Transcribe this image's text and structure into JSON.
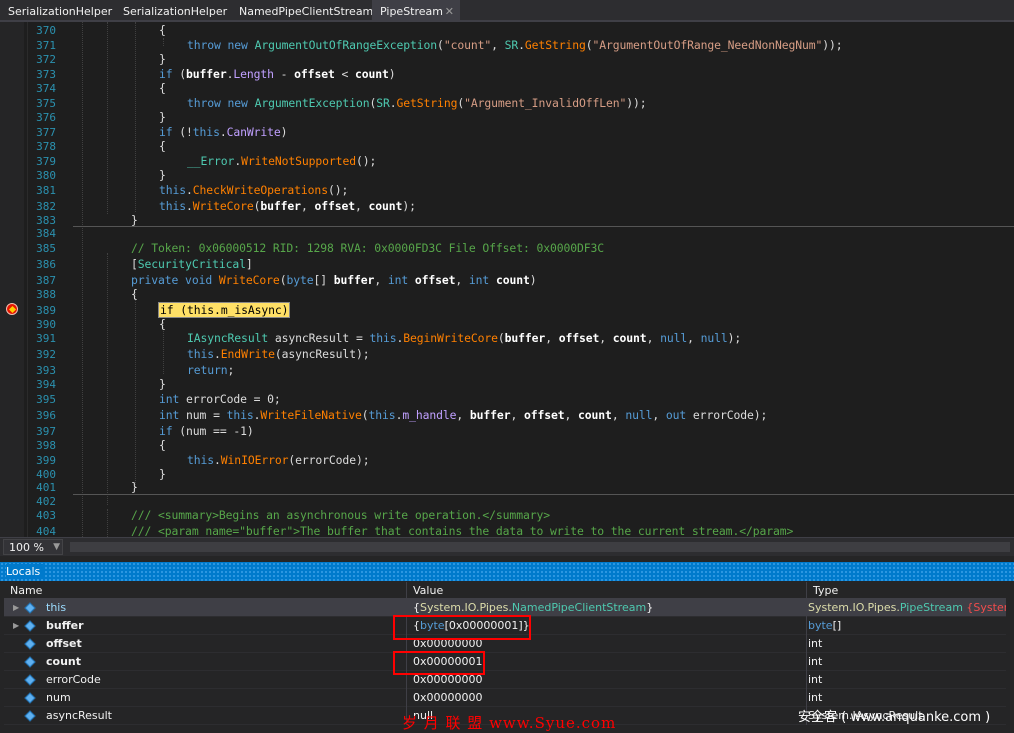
{
  "tabs": [
    {
      "label": "SerializationHelper"
    },
    {
      "label": "SerializationHelper"
    },
    {
      "label": "NamedPipeClientStream"
    },
    {
      "label": "PipeStream",
      "active": true
    }
  ],
  "tab_close_glyph": "✕",
  "editor": {
    "breakpoint_line": "389",
    "breakpoint_color": "#e51400",
    "highlight_color": "#ffe066",
    "lines": [
      {
        "n": "370"
      },
      {
        "n": "371"
      },
      {
        "n": "372"
      },
      {
        "n": "373"
      },
      {
        "n": "374"
      },
      {
        "n": "375"
      },
      {
        "n": "376"
      },
      {
        "n": "377"
      },
      {
        "n": "378"
      },
      {
        "n": "379"
      },
      {
        "n": "380"
      },
      {
        "n": "381"
      },
      {
        "n": "382"
      },
      {
        "n": "383"
      },
      {
        "n": "384"
      },
      {
        "n": "385"
      },
      {
        "n": "386"
      },
      {
        "n": "387"
      },
      {
        "n": "388"
      },
      {
        "n": "389"
      },
      {
        "n": "390"
      },
      {
        "n": "391"
      },
      {
        "n": "392"
      },
      {
        "n": "393"
      },
      {
        "n": "394"
      },
      {
        "n": "395"
      },
      {
        "n": "396"
      },
      {
        "n": "397"
      },
      {
        "n": "398"
      },
      {
        "n": "399"
      },
      {
        "n": "400"
      },
      {
        "n": "401"
      },
      {
        "n": "402"
      },
      {
        "n": "403"
      },
      {
        "n": "404"
      }
    ],
    "code": {
      "l370": "{",
      "l371": "throw new ArgumentOutOfRangeException(\"count\", SR.GetString(\"ArgumentOutOfRange_NeedNonNegNum\"));",
      "l372": "}",
      "l373": "if (buffer.Length - offset < count)",
      "l374": "{",
      "l375": "throw new ArgumentException(SR.GetString(\"Argument_InvalidOffLen\"));",
      "l376": "}",
      "l377": "if (!this.CanWrite)",
      "l378": "{",
      "l379": "__Error.WriteNotSupported();",
      "l380": "}",
      "l381": "this.CheckWriteOperations();",
      "l382": "this.WriteCore(buffer, offset, count);",
      "l383": "}",
      "l385": "// Token: 0x06000512 RID: 1298 RVA: 0x0000FD3C File Offset: 0x0000DF3C",
      "l386": "[SecurityCritical]",
      "l387": "private void WriteCore(byte[] buffer, int offset, int count)",
      "l388": "{",
      "l389": "if (this.m_isAsync)",
      "l390": "{",
      "l391": "IAsyncResult asyncResult = this.BeginWriteCore(buffer, offset, count, null, null);",
      "l392": "this.EndWrite(asyncResult);",
      "l393": "return;",
      "l394": "}",
      "l395": "int errorCode = 0;",
      "l396": "int num = this.WriteFileNative(this.m_handle, buffer, offset, count, null, out errorCode);",
      "l397": "if (num == -1)",
      "l398": "{",
      "l399": "this.WinIOError(errorCode);",
      "l400": "}",
      "l401": "}",
      "l403": "/// <summary>Begins an asynchronous write operation.</summary>",
      "l404": "/// <param name=\"buffer\">The buffer that contains the data to write to the current stream.</param>"
    }
  },
  "zoom": {
    "value": "100 %"
  },
  "locals": {
    "title": "Locals",
    "columns": {
      "name": "Name",
      "value": "Value",
      "type": "Type"
    },
    "rows": [
      {
        "name": "this",
        "value": "{System.IO.Pipes.NamedPipeClientStream}",
        "type": "System.IO.Pipes.PipeStream {System....",
        "expandable": true
      },
      {
        "name": "buffer",
        "value": "{byte[0x00000001]}",
        "type": "byte[]",
        "expandable": true
      },
      {
        "name": "offset",
        "value": "0x00000000",
        "type": "int"
      },
      {
        "name": "count",
        "value": "0x00000001",
        "type": "int"
      },
      {
        "name": "errorCode",
        "value": "0x00000000",
        "type": "int"
      },
      {
        "name": "num",
        "value": "0x00000000",
        "type": "int"
      },
      {
        "name": "asyncResult",
        "value": "null",
        "type": "System.IAsyncResult"
      }
    ],
    "expand_glyph": "▶"
  },
  "watermarks": {
    "left": "岁 月 联 盟  www.Syue.com",
    "right": "安全客 ( www.anquanke.com )"
  }
}
